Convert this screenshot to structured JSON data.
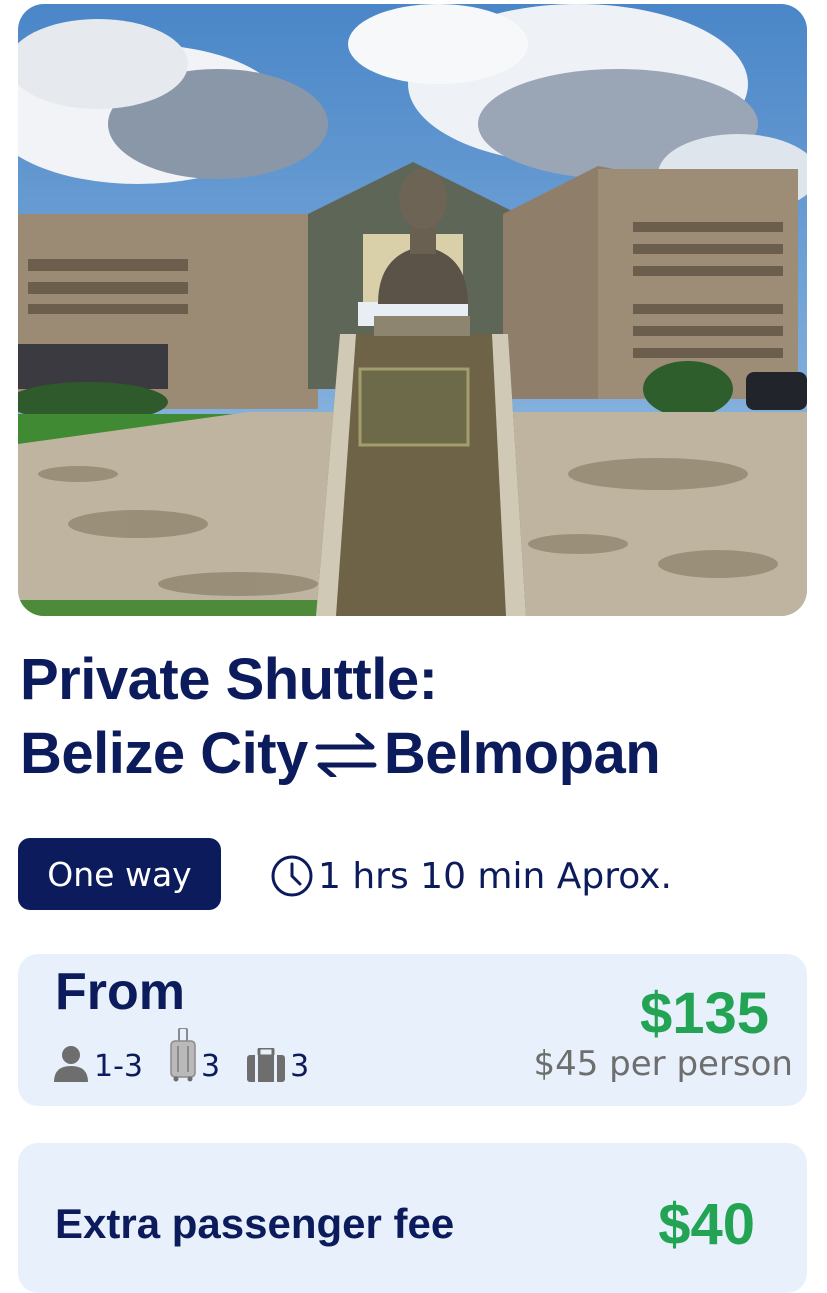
{
  "hero": {
    "image": "building-with-bust-statue-photo"
  },
  "title": {
    "line1": "Private Shuttle:",
    "origin": "Belize City",
    "destination": "Belmopan",
    "swap_icon": "swap-arrows-icon"
  },
  "trip": {
    "type_label": "One way",
    "duration_icon": "clock-icon",
    "duration": "1 hrs  10 min Aprox."
  },
  "pricing": {
    "from_label": "From",
    "passengers": {
      "icon": "person-icon",
      "value": "1-3"
    },
    "large_luggage": {
      "icon": "suitcase-icon",
      "value": "3"
    },
    "carry_on": {
      "icon": "briefcase-icon",
      "value": "3"
    },
    "price": "$135",
    "per_person": "$45 per person"
  },
  "extra": {
    "label": "Extra passenger fee",
    "price": "$40"
  },
  "colors": {
    "navy": "#0c1b5c",
    "green": "#22a454",
    "card_bg": "#e8f1fb",
    "muted": "#6e6e6e"
  }
}
